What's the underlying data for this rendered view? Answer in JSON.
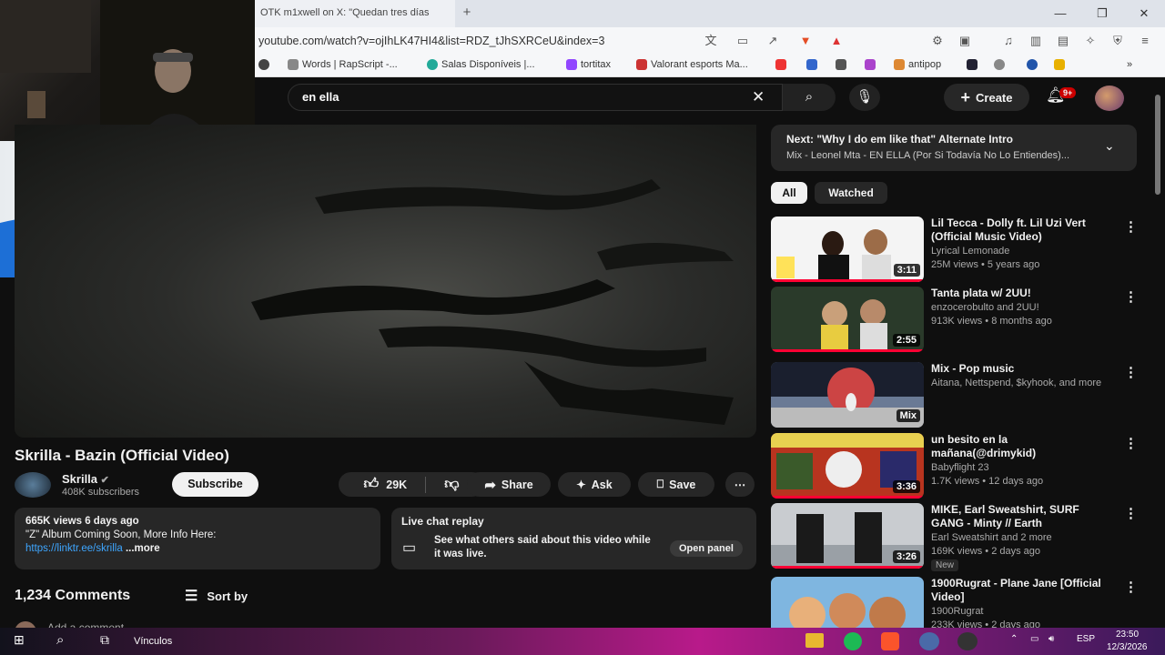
{
  "browser": {
    "tab_title": "OTK m1xwell on X: \"Quedan tres días",
    "url": "youtube.com/watch?v=ojIhLK47HI4&list=RDZ_tJhSXRCeU&index=3",
    "bookmarks": [
      "Words | RapScript -...",
      "Salas Disponíveis |...",
      "tortitax",
      "Valorant esports Ma...",
      "antipop"
    ]
  },
  "youtube": {
    "search_value": "en ella",
    "create_label": "Create",
    "notif_count": "9+",
    "video_title": "Skrilla - Bazin (Official Video)",
    "channel_name": "Skrilla",
    "subscribers": "408K subscribers",
    "subscribe_label": "Subscribe",
    "likes": "29K",
    "share_label": "Share",
    "ask_label": "Ask",
    "save_label": "Save",
    "views_line": "665K views  6 days ago",
    "desc_line": "\"Z\" Album Coming Soon, More Info Here:",
    "desc_link": "https://linktr.ee/skrilla",
    "more_label": "...more",
    "live_chat_title": "Live chat replay",
    "live_chat_desc": "See what others said about this video while it was live.",
    "open_panel_label": "Open panel",
    "comments_count": "1,234 Comments",
    "sort_label": "Sort by",
    "add_comment": "Add a comment..."
  },
  "sidebar": {
    "next_title": "Next: \"Why I do em like that\" Alternate Intro",
    "next_sub": "Mix - Leonel Mta - EN ELLA (Por Si Todavía No Lo Entiendes)...",
    "chips": [
      "All",
      "Watched"
    ],
    "recs": [
      {
        "title": "Lil Tecca - Dolly ft. Lil Uzi Vert (Official Music Video)",
        "channel": "Lyrical Lemonade",
        "meta": "25M views • 5 years ago",
        "duration": "3:11"
      },
      {
        "title": "Tanta plata w/ 2UU!",
        "channel": "enzocerobulto and 2UU!",
        "meta": "913K views • 8 months ago",
        "duration": "2:55"
      },
      {
        "title": "Mix - Pop music",
        "channel": "Aitana, Nettspend, $kyhook, and more",
        "meta": "",
        "duration": "Mix"
      },
      {
        "title": "un besito en la mañana(@drimykid)",
        "channel": "Babyflight 23",
        "meta": "1.7K views • 12 days ago",
        "duration": "3:36"
      },
      {
        "title": "MIKE, Earl Sweatshirt, SURF GANG - Minty // Earth",
        "channel": "Earl Sweatshirt and 2 more",
        "meta": "169K views • 2 days ago",
        "duration": "3:26",
        "badge": "New"
      },
      {
        "title": "1900Rugrat - Plane Jane [Official Video]",
        "channel": "1900Rugrat",
        "meta": "233K views • 2 days ago",
        "duration": ""
      }
    ]
  },
  "taskbar": {
    "vinculos": "Vínculos",
    "lang": "ESP",
    "time": "23:50",
    "date": "12/3/2026"
  }
}
